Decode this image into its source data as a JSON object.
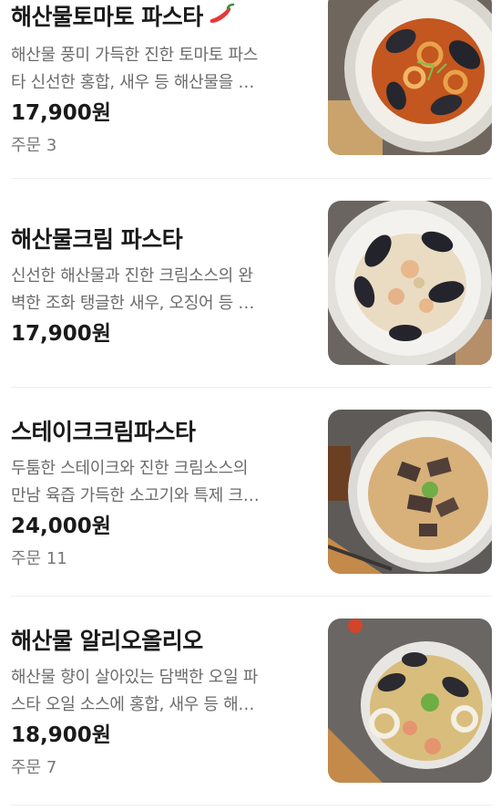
{
  "menu": {
    "items": [
      {
        "name": "해산물토마토 파스타",
        "spicy_icon": "chili-pepper-icon",
        "desc_line1": "해산물 풍미 가득한 진한 토마토 파스",
        "desc_line2": "타 신선한 홍합, 새우 등 해산물을 …",
        "price": "17,900원",
        "orders": "주문 3"
      },
      {
        "name": "해산물크림 파스타",
        "desc_line1": "신선한 해산물과 진한 크림소스의 완",
        "desc_line2": "벽한 조화 탱글한 새우, 오징어 등 …",
        "price": "17,900원"
      },
      {
        "name": "스테이크크림파스타",
        "desc_line1": "두툼한 스테이크와 진한 크림소스의",
        "desc_line2": "만남 육즙 가득한 소고기와 특제 크…",
        "price": "24,000원",
        "orders": "주문 11"
      },
      {
        "name": "해산물 알리오올리오",
        "desc_line1": "해산물 향이 살아있는 담백한 오일 파",
        "desc_line2": "스타 오일 소스에 홍합, 새우 등 해…",
        "price": "18,900원",
        "orders": "주문 7"
      }
    ]
  },
  "colors": {
    "text_primary": "#1a1a1a",
    "text_secondary": "#6b6b6b",
    "chili_red": "#e53935",
    "divider": "#eeeeee"
  }
}
